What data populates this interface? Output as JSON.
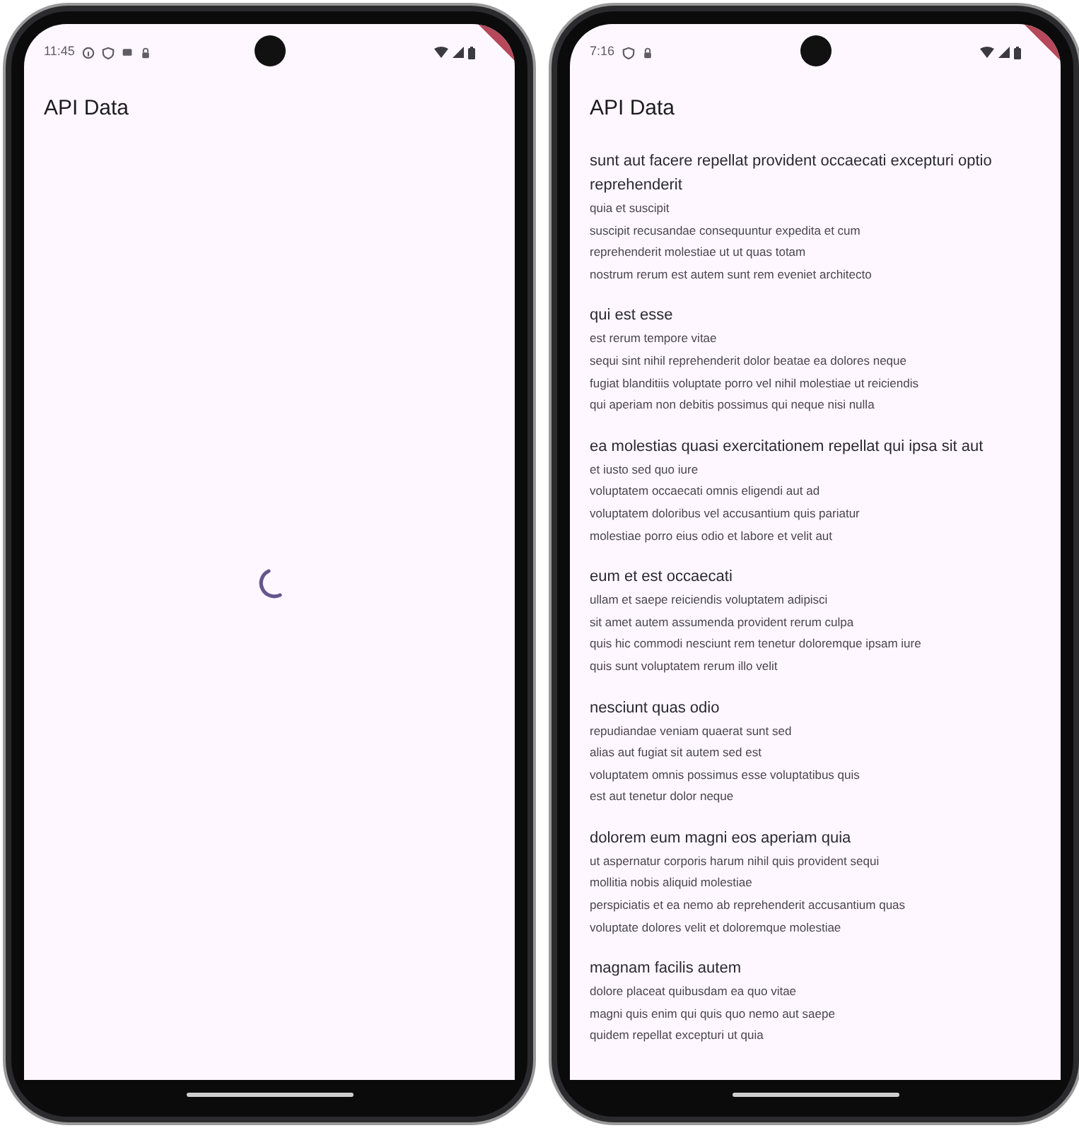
{
  "phones": [
    {
      "status_bar": {
        "time": "11:45",
        "notifications": [
          {
            "kind": "info"
          },
          {
            "kind": "shield"
          },
          {
            "kind": "square"
          },
          {
            "kind": "lock"
          }
        ]
      },
      "app_bar": {
        "title": "API Data"
      },
      "content": {
        "kind": "loading"
      }
    },
    {
      "status_bar": {
        "time": "7:16",
        "notifications": [
          {
            "kind": "shield"
          },
          {
            "kind": "lock"
          }
        ]
      },
      "app_bar": {
        "title": "API Data"
      },
      "content": {
        "kind": "list",
        "posts": [
          {
            "title": "sunt aut facere repellat provident occaecati excepturi optio reprehenderit",
            "body": [
              "quia et suscipit",
              "suscipit recusandae consequuntur expedita et cum",
              "reprehenderit molestiae ut ut quas totam",
              "nostrum rerum est autem sunt rem eveniet architecto"
            ]
          },
          {
            "title": "qui est esse",
            "body": [
              "est rerum tempore vitae",
              "sequi sint nihil reprehenderit dolor beatae ea dolores neque",
              "fugiat blanditiis voluptate porro vel nihil molestiae ut reiciendis",
              "qui aperiam non debitis possimus qui neque nisi nulla"
            ]
          },
          {
            "title": "ea molestias quasi exercitationem repellat qui ipsa sit aut",
            "body": [
              "et iusto sed quo iure",
              "voluptatem occaecati omnis eligendi aut ad",
              "voluptatem doloribus vel accusantium quis pariatur",
              "molestiae porro eius odio et labore et velit aut"
            ]
          },
          {
            "title": "eum et est occaecati",
            "body": [
              "ullam et saepe reiciendis voluptatem adipisci",
              "sit amet autem assumenda provident rerum culpa",
              "quis hic commodi nesciunt rem tenetur doloremque ipsam iure",
              "quis sunt voluptatem rerum illo velit"
            ]
          },
          {
            "title": "nesciunt quas odio",
            "body": [
              "repudiandae veniam quaerat sunt sed",
              "alias aut fugiat sit autem sed est",
              "voluptatem omnis possimus esse voluptatibus quis",
              "est aut tenetur dolor neque"
            ]
          },
          {
            "title": "dolorem eum magni eos aperiam quia",
            "body": [
              "ut aspernatur corporis harum nihil quis provident sequi",
              "mollitia nobis aliquid molestiae",
              "perspiciatis et ea nemo ab reprehenderit accusantium quas",
              "voluptate dolores velit et doloremque molestiae"
            ]
          },
          {
            "title": "magnam facilis autem",
            "body": [
              "dolore placeat quibusdam ea quo vitae",
              "magni quis enim qui quis quo nemo aut saepe",
              "quidem repellat excepturi ut quia"
            ]
          }
        ]
      }
    }
  ]
}
